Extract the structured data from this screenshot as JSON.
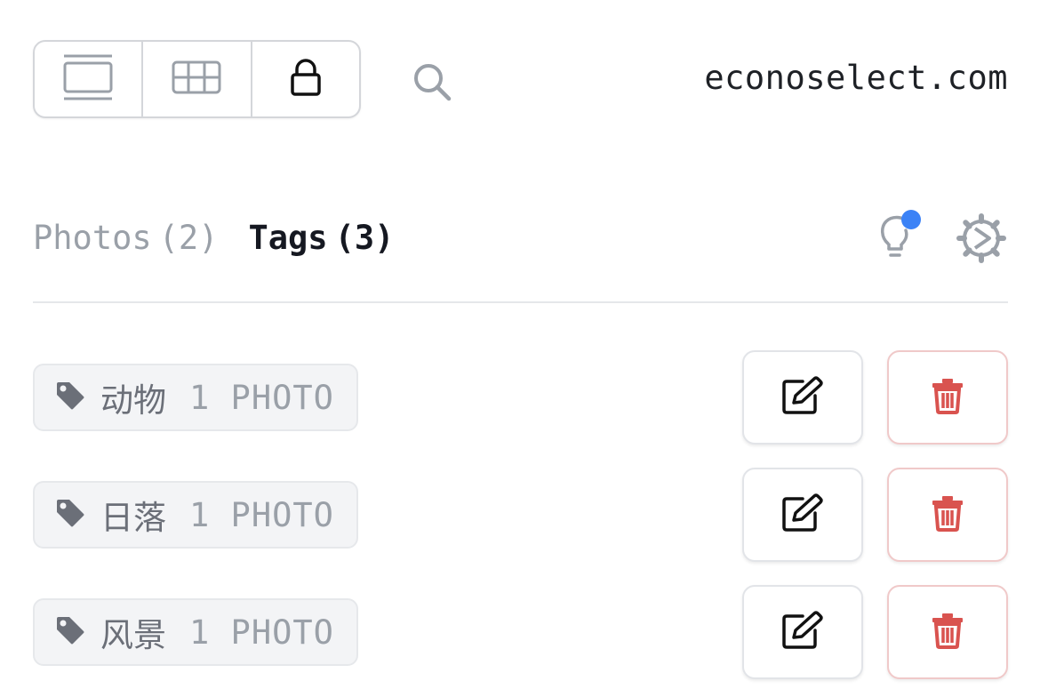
{
  "header": {
    "site_name": "econoselect.com",
    "view_modes": [
      {
        "icon": "single-view-icon",
        "active": false
      },
      {
        "icon": "grid-view-icon",
        "active": false
      },
      {
        "icon": "lock-icon",
        "active": true
      }
    ],
    "search_icon": "search-icon"
  },
  "tabs": [
    {
      "label": "Photos",
      "count": "(2)",
      "active": false
    },
    {
      "label": "Tags",
      "count": "(3)",
      "active": true
    }
  ],
  "toolbar": {
    "hint_icon": "lightbulb-icon",
    "settings_icon": "gear-icon"
  },
  "tags": [
    {
      "name": "动物",
      "count": "1 PHOTO"
    },
    {
      "name": "日落",
      "count": "1 PHOTO"
    },
    {
      "name": "风景",
      "count": "1 PHOTO"
    }
  ],
  "colors": {
    "accent": "#3b82f6",
    "danger": "#d9534f",
    "muted": "#9aa0a8",
    "text": "#151821"
  }
}
